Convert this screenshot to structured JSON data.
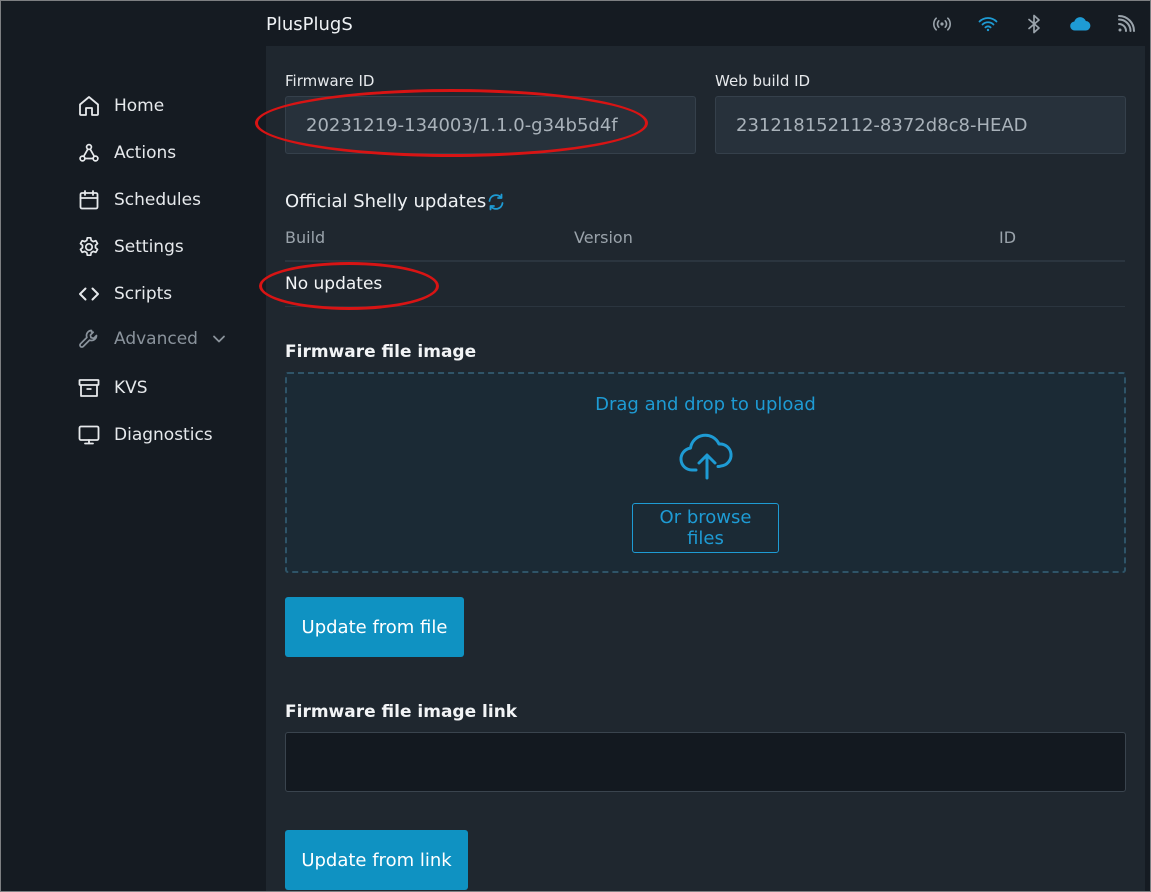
{
  "app": {
    "title": "PlusPlugS"
  },
  "status_icons": [
    "signal-broadcast-icon",
    "wifi-icon",
    "bluetooth-icon",
    "cloud-icon",
    "rss-icon"
  ],
  "sidebar": {
    "items": [
      {
        "label": "Home",
        "icon": "home-icon"
      },
      {
        "label": "Actions",
        "icon": "webhook-icon"
      },
      {
        "label": "Schedules",
        "icon": "calendar-icon"
      },
      {
        "label": "Settings",
        "icon": "gear-icon"
      },
      {
        "label": "Scripts",
        "icon": "code-icon"
      },
      {
        "label": "Advanced",
        "icon": "wrench-icon"
      },
      {
        "label": "KVS",
        "icon": "archive-icon"
      },
      {
        "label": "Diagnostics",
        "icon": "monitor-icon"
      }
    ]
  },
  "firmware": {
    "id_label": "Firmware ID",
    "id_value": "20231219-134003/1.1.0-g34b5d4f",
    "web_build_label": "Web build ID",
    "web_build_value": "231218152112-8372d8c8-HEAD"
  },
  "updates": {
    "title": "Official Shelly updates",
    "columns": [
      "Build",
      "Version",
      "ID"
    ],
    "empty_text": "No updates"
  },
  "file_image": {
    "title": "Firmware file image",
    "drop_text": "Drag and drop to upload",
    "browse_label": "Or browse files",
    "update_button": "Update from file"
  },
  "file_link": {
    "title": "Firmware file image link",
    "value": "",
    "update_button": "Update from link"
  },
  "colors": {
    "accent": "#0f92c2",
    "annotation": "#d81414",
    "background": "#1f272f",
    "sidebar": "#151b22"
  }
}
